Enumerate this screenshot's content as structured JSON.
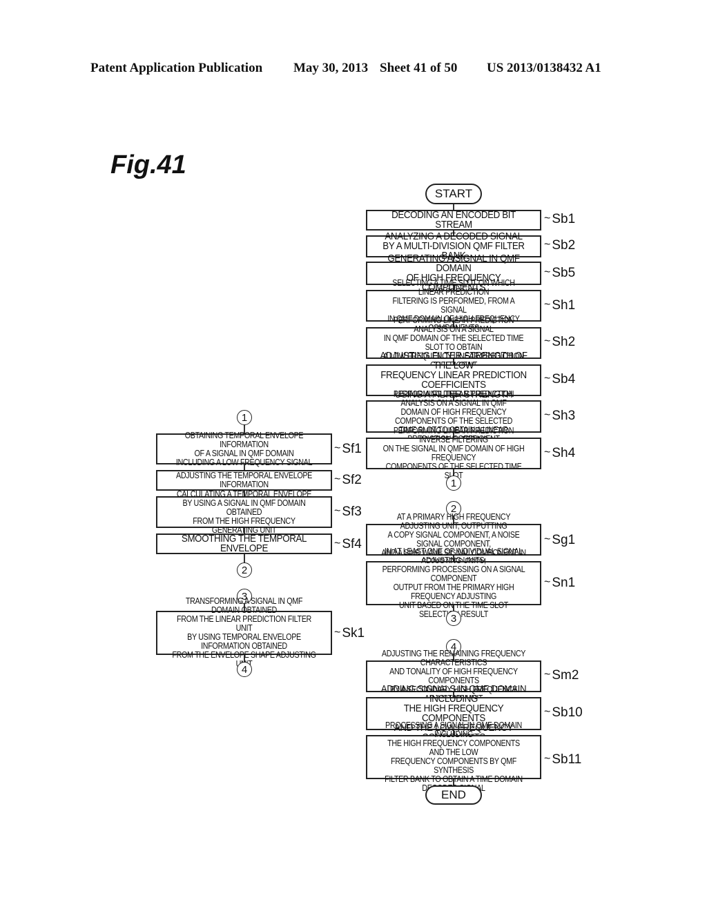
{
  "header": {
    "publication": "Patent Application Publication",
    "date": "May 30, 2013",
    "sheet": "Sheet 41 of 50",
    "number": "US 2013/0138432 A1"
  },
  "figure": {
    "label": "Fig.41"
  },
  "right_flow": {
    "start": "START",
    "end": "END",
    "steps": [
      {
        "id": "Sb1",
        "text": "DECODING AN ENCODED BIT STREAM"
      },
      {
        "id": "Sb2",
        "text": "ANALYZING A DECODED SIGNAL\nBY A MULTI-DIVISION QMF FILTER BANK"
      },
      {
        "id": "Sb5",
        "text": "GENERATING A SIGNAL IN QMF DOMAIN\nOF HIGH FREQUENCY COMPONENTS"
      },
      {
        "id": "Sh1",
        "text": "SELECTING A TIME SLOT ON WHICH LINEAR PREDICTION\nFILTERING IS PERFORMED, FROM A SIGNAL\nIN QMF DOMAIN OF HIGH FREQUENCY COMPONENTS"
      },
      {
        "id": "Sh2",
        "text": "PERFORMING LINEAR PREDICTION ANALYSIS ON A SIGNAL\nIN QMF DOMAIN OF THE SELECTED TIME SLOT TO OBTAIN\nA LOW FREQUENCY LINEAR PREDICTION COEFFICIENT"
      },
      {
        "id": "Sb4",
        "text": "ADJUSTING FILTER STRENGTH OF THE LOW\nFREQUENCY LINEAR PREDICTION COEFFICIENTS\nUSING A FILTER STRENGTH PARAMETER"
      },
      {
        "id": "Sh3",
        "text": "PERFORMING LINEAR PREDICTION ANALYSIS ON A SIGNAL IN QMF\nDOMAIN OF HIGH FREQUENCY COMPONENTS OF THE SELECTED\nTIME SLOT TO OBTAIN A LINEAR PREDICTION COEFFICIENT"
      },
      {
        "id": "Sh4",
        "text": "PERFORMING LINEAR PREDICTION INVERSE FILTERING\nON THE SIGNAL IN QMF DOMAIN OF HIGH FREQUENCY\nCOMPONENTS OF THE SELECTED TIME SLOT"
      },
      {
        "id": "Sg1",
        "text": "AT A PRIMARY HIGH FREQUENCY ADJUSTING UNIT, OUTPUTTING\nA COPY SIGNAL COMPONENT, A NOISE SIGNAL COMPONENT,\nAND A SINE WAVE SIGNAL COMPONENT IN SEPARATED FORM"
      },
      {
        "id": "Sn1",
        "text": "IN AT LEAST ONE OF INDIVIDUAL SIGNAL ADJUSTING UNITS,\nPERFORMING PROCESSING ON A SIGNAL COMPONENT\nOUTPUT FROM THE PRIMARY HIGH FREQUENCY ADJUSTING\nUNIT BASED ON THE TIME SLOT SELECTION RESULT"
      },
      {
        "id": "Sm2",
        "text": "ADJUSTING THE REMAINING FREQUENCY CHARACTERISTICS\nAND TONALITY OF HIGH FREQUENCY COMPONENTS\nBY A SECONDARY HIGH FREQUENCY ADJUSTING UNIT"
      },
      {
        "id": "Sb10",
        "text": "ADDING SIGNALS IN QMF DOMAIN INCLUDING\nTHE HIGH FREQUENCY COMPONENTS\nAND THE LOW FREQUENCY COMPONENTS"
      },
      {
        "id": "Sb11",
        "text": "PROCESSING A SIGNAL IN QMF DOMAIN INCLUDING\nTHE HIGH FREQUENCY COMPONENTS AND THE LOW\nFREQUENCY COMPONENTS BY QMF SYNTHESIS\nFILTER BANK TO OBTAIN A TIME DOMAIN DECODED SIGNAL"
      }
    ],
    "connectors": [
      "1",
      "2",
      "3",
      "4"
    ]
  },
  "left_flow": {
    "steps": [
      {
        "id": "Sf1",
        "text": "OBTAINING TEMPORAL ENVELOPE INFORMATION\nOF A SIGNAL IN QMF DOMAIN\nINCLUDING A LOW FREQUENCY SIGNAL"
      },
      {
        "id": "Sf2",
        "text": "ADJUSTING THE TEMPORAL ENVELOPE INFORMATION"
      },
      {
        "id": "Sf3",
        "text": "CALCULATING A TEMPORAL ENVELOPE\nBY USING A SIGNAL IN QMF DOMAIN OBTAINED\nFROM THE HIGH FREQUENCY GENERATING UNIT"
      },
      {
        "id": "Sf4",
        "text": "SMOOTHING THE TEMPORAL ENVELOPE"
      },
      {
        "id": "Sk1",
        "text": "TRANSFORMING A SIGNAL IN QMF DOMAIN OBTAINED\nFROM THE LINEAR PREDICTION FILTER UNIT\nBY USING TEMPORAL ENVELOPE INFORMATION OBTAINED\nFROM THE ENVELOPE SHAPE ADJUSTING UNIT"
      }
    ],
    "connectors": [
      "1",
      "2",
      "3",
      "4"
    ]
  }
}
